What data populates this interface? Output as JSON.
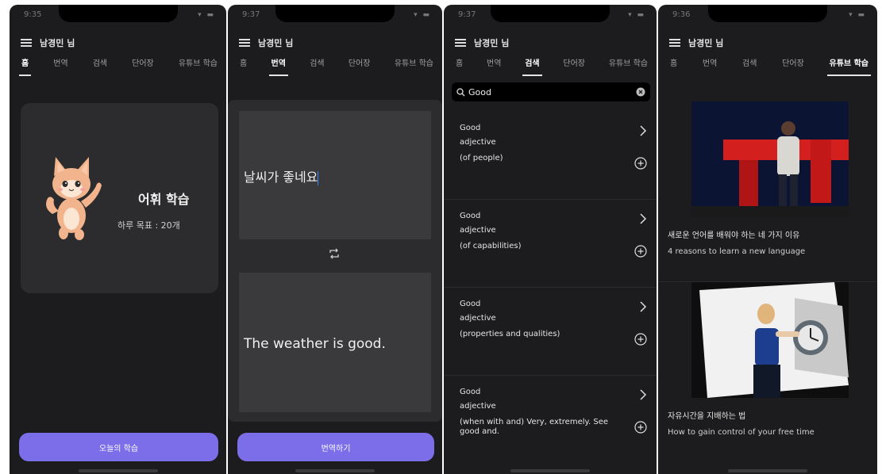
{
  "status": {
    "time": "9:37",
    "time_home": "9:35",
    "time_video": "9:36",
    "icons": "▾ ▬"
  },
  "user": {
    "name": "남경민 님"
  },
  "tabs": [
    "홈",
    "번역",
    "검색",
    "단어장",
    "유튜브 학습"
  ],
  "active_tabs": {
    "home": 0,
    "translate": 1,
    "search": 2,
    "youtube": 4
  },
  "home": {
    "card_title": "어휘 학습",
    "goal_text": "하루 목표  :  20개",
    "button_label": "오늘의 학습"
  },
  "translate": {
    "source_text": "날씨가 좋네요",
    "target_text": "The weather is good.",
    "button_label": "번역하기"
  },
  "search": {
    "query": "Good",
    "results": [
      {
        "word": "Good",
        "pos": "adjective",
        "definition": "(of people)"
      },
      {
        "word": "Good",
        "pos": "adjective",
        "definition": "(of capabilities)"
      },
      {
        "word": "Good",
        "pos": "adjective",
        "definition": "(properties and qualities)"
      },
      {
        "word": "Good",
        "pos": "adjective",
        "definition": "(when with and) Very, extremely. See good and."
      }
    ]
  },
  "youtube": {
    "videos": [
      {
        "title": "새로운 언어를 배워야 하는 네 가지 이유",
        "subtitle": "4 reasons to learn a new language"
      },
      {
        "title": "자유시간을 지배하는 법",
        "subtitle": "How to gain control of your free time"
      }
    ]
  },
  "colors": {
    "background": "#1c1c1e",
    "card": "#2c2c2e",
    "accent": "#7c6de8"
  }
}
